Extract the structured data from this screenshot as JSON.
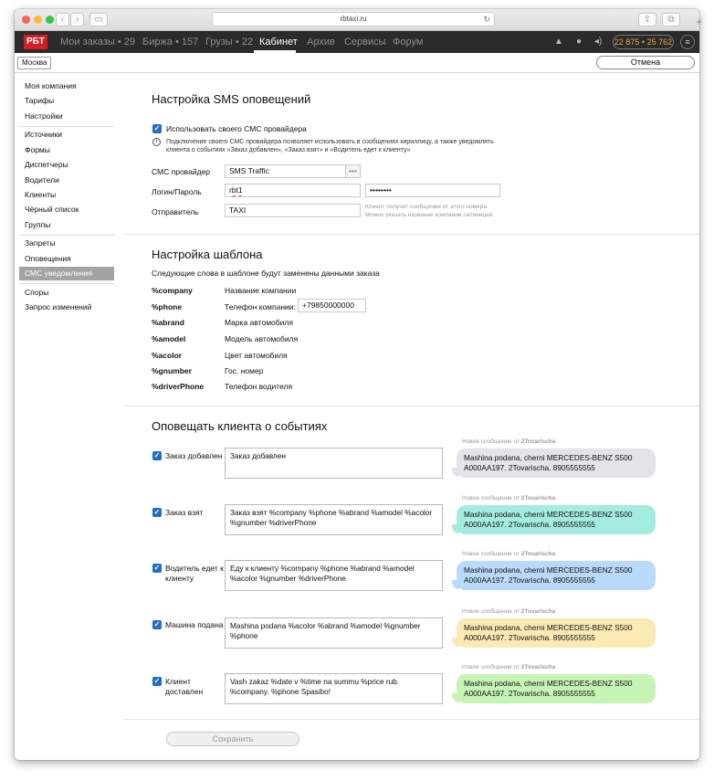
{
  "browser": {
    "url": "rbtaxi.ru"
  },
  "nav": {
    "logo": "РБТ",
    "items": [
      "Мои заказы • 29",
      "Биржа • 157",
      "Грузы • 22",
      "Кабинет",
      "Архив",
      "Сервисы",
      "Форум"
    ],
    "active": "Кабинет",
    "balance": "22 875 • 25 762",
    "balance_accent": "#e8a33c"
  },
  "subbar": {
    "city": "Москва",
    "cancel": "Отмена"
  },
  "sidebar": {
    "group1": [
      "Моя компания",
      "Тарифы",
      "Настройки"
    ],
    "group2": [
      "Источники",
      "Формы",
      "Диспетчеры",
      "Водители",
      "Клиенты",
      "Чёрный список",
      "Группы"
    ],
    "group3": [
      "Запреты",
      "Оповещения",
      "СМС уведомления"
    ],
    "group4": [
      "Споры",
      "Запрос изменений"
    ],
    "active": "СМС уведомления"
  },
  "sms": {
    "title": "Настройка SMS оповещений",
    "use_own": "Использовать своего СМС провайдера",
    "info1": "Подключение своего СМС провайдера позволяет использовать в сообщениях кириллицу, а также уведомлять",
    "info2": "клиента о событиях «Заказ добавлен», «Заказ взят» и «Водитель едет к клиенту»",
    "provider_label": "СМС провайдер",
    "provider_value": "SMS Traffic",
    "login_label": "Логин/Пароль",
    "login_value": "rbt1",
    "password_value": "••••••••",
    "sender_label": "Отправитель",
    "sender_value": "TAXI",
    "sender_hint1": "Клиент получит сообщение от этого номера.",
    "sender_hint2": "Можно указать название компании латиницей."
  },
  "template": {
    "title": "Настройка шаблона",
    "subtitle": "Следующие слова в шаблоне будут заменены данными заказа",
    "vars": [
      {
        "key": "%company",
        "desc": "Название компании"
      },
      {
        "key": "%phone",
        "desc": "Телефон компании:",
        "input": "+79850000000"
      },
      {
        "key": "%abrand",
        "desc": "Марка автомобиля"
      },
      {
        "key": "%amodel",
        "desc": "Модель автомобиля"
      },
      {
        "key": "%acolor",
        "desc": "Цвет автомобиля"
      },
      {
        "key": "%gnumber",
        "desc": "Гос. номер"
      },
      {
        "key": "%driverPhone",
        "desc": "Телефон водителя"
      }
    ]
  },
  "events": {
    "title": "Оповещать клиента о событиях",
    "preview_label": "Новое сообщение от",
    "preview_sender": "2Tovarischa",
    "preview_text": "Mashina podana, cherni MERCEDES-BENZ S500 A000AA197. 2Tovarischa. 8905555555",
    "items": [
      {
        "label": "Заказ добавлен",
        "text": "Заказ добавлен",
        "bubble_color": "#e3e3e8"
      },
      {
        "label": "Заказ взят",
        "text": "Заказ взят %company %phone %abrand %amodel %acolor %gnumber %driverPhone",
        "bubble_color": "#a4ece0"
      },
      {
        "label": "Водитель едет к клиенту",
        "text": "Еду к клиенту %company %phone %abrand %amodel %acolor %gnumber %driverPhone",
        "bubble_color": "#b9dafb"
      },
      {
        "label": "Машина подана",
        "text": "Mashina podana %acolor %abrand %amodel %gnumber %phone",
        "bubble_color": "#fbeab3"
      },
      {
        "label": "Клиент доставлен",
        "text": "Vash zakaz %date v %time na summu %price rub. %company. %phone Spasibo!",
        "bubble_color": "#c6f4b4"
      }
    ]
  },
  "save": "Сохранить"
}
